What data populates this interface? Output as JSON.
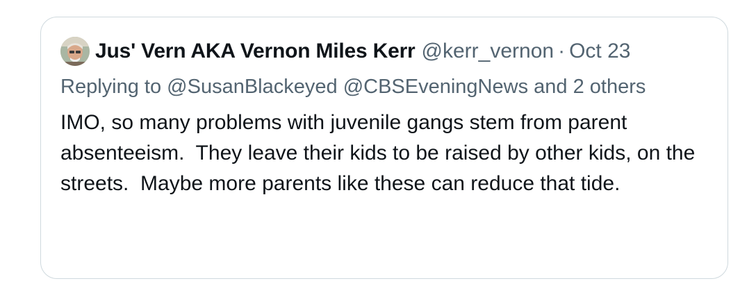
{
  "tweet": {
    "author_name": "Jus' Vern AKA Vernon Miles Kerr",
    "author_handle": "@kerr_vernon",
    "separator": "·",
    "date": "Oct 23",
    "replying_prefix": "Replying to ",
    "replying_mention_1": "@SusanBlackeyed",
    "replying_mention_2": "@CBSEveningNews",
    "replying_suffix": " and 2 others",
    "text": "IMO, so many problems with juvenile gangs stem from parent absenteeism.  They leave their kids to be raised by other kids, on the streets.  Maybe more parents like these can reduce that tide."
  },
  "colors": {
    "border": "#cfd9de",
    "primary_text": "#0f1419",
    "secondary_text": "#536471"
  },
  "icons": {
    "avatar": "user-avatar-photo"
  }
}
